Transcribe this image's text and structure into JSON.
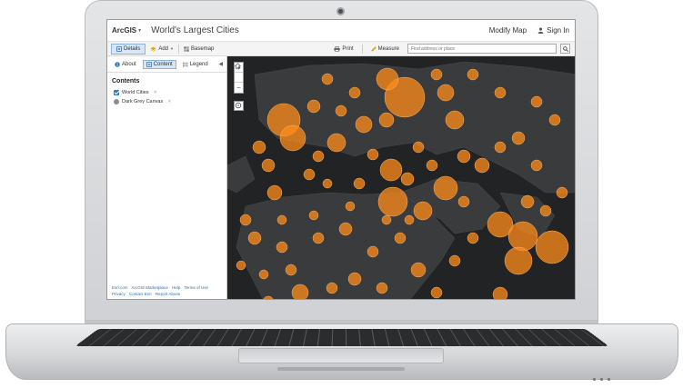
{
  "app": {
    "brand": "ArcGIS",
    "title": "World's Largest Cities",
    "modify_map": "Modify Map",
    "sign_in": "Sign In"
  },
  "toolbar": {
    "details": "Details",
    "add": "Add",
    "basemap": "Basemap",
    "print": "Print",
    "measure": "Measure",
    "search_placeholder": "Find address or place"
  },
  "sidebar": {
    "tabs": [
      "About",
      "Content",
      "Legend"
    ],
    "contents_title": "Contents",
    "layers": [
      "World Cities",
      "Dark Grey Canvas"
    ],
    "footer_links": [
      "Esri.com",
      "ArcGIS Marketplace",
      "Help",
      "Terms of Use",
      "Privacy",
      "Contact Esri",
      "Report Abuse"
    ]
  },
  "map": {
    "zoom_in": "+",
    "zoom_out": "−",
    "background_color": "#222324",
    "land_color": "#3a3b3d",
    "marker_color": "#ff8c1a"
  },
  "icons": [
    "camera-icon",
    "user-icon",
    "search-icon",
    "print-icon",
    "measure-icon",
    "home-icon",
    "locate-icon",
    "info-icon",
    "legend-icon"
  ]
}
